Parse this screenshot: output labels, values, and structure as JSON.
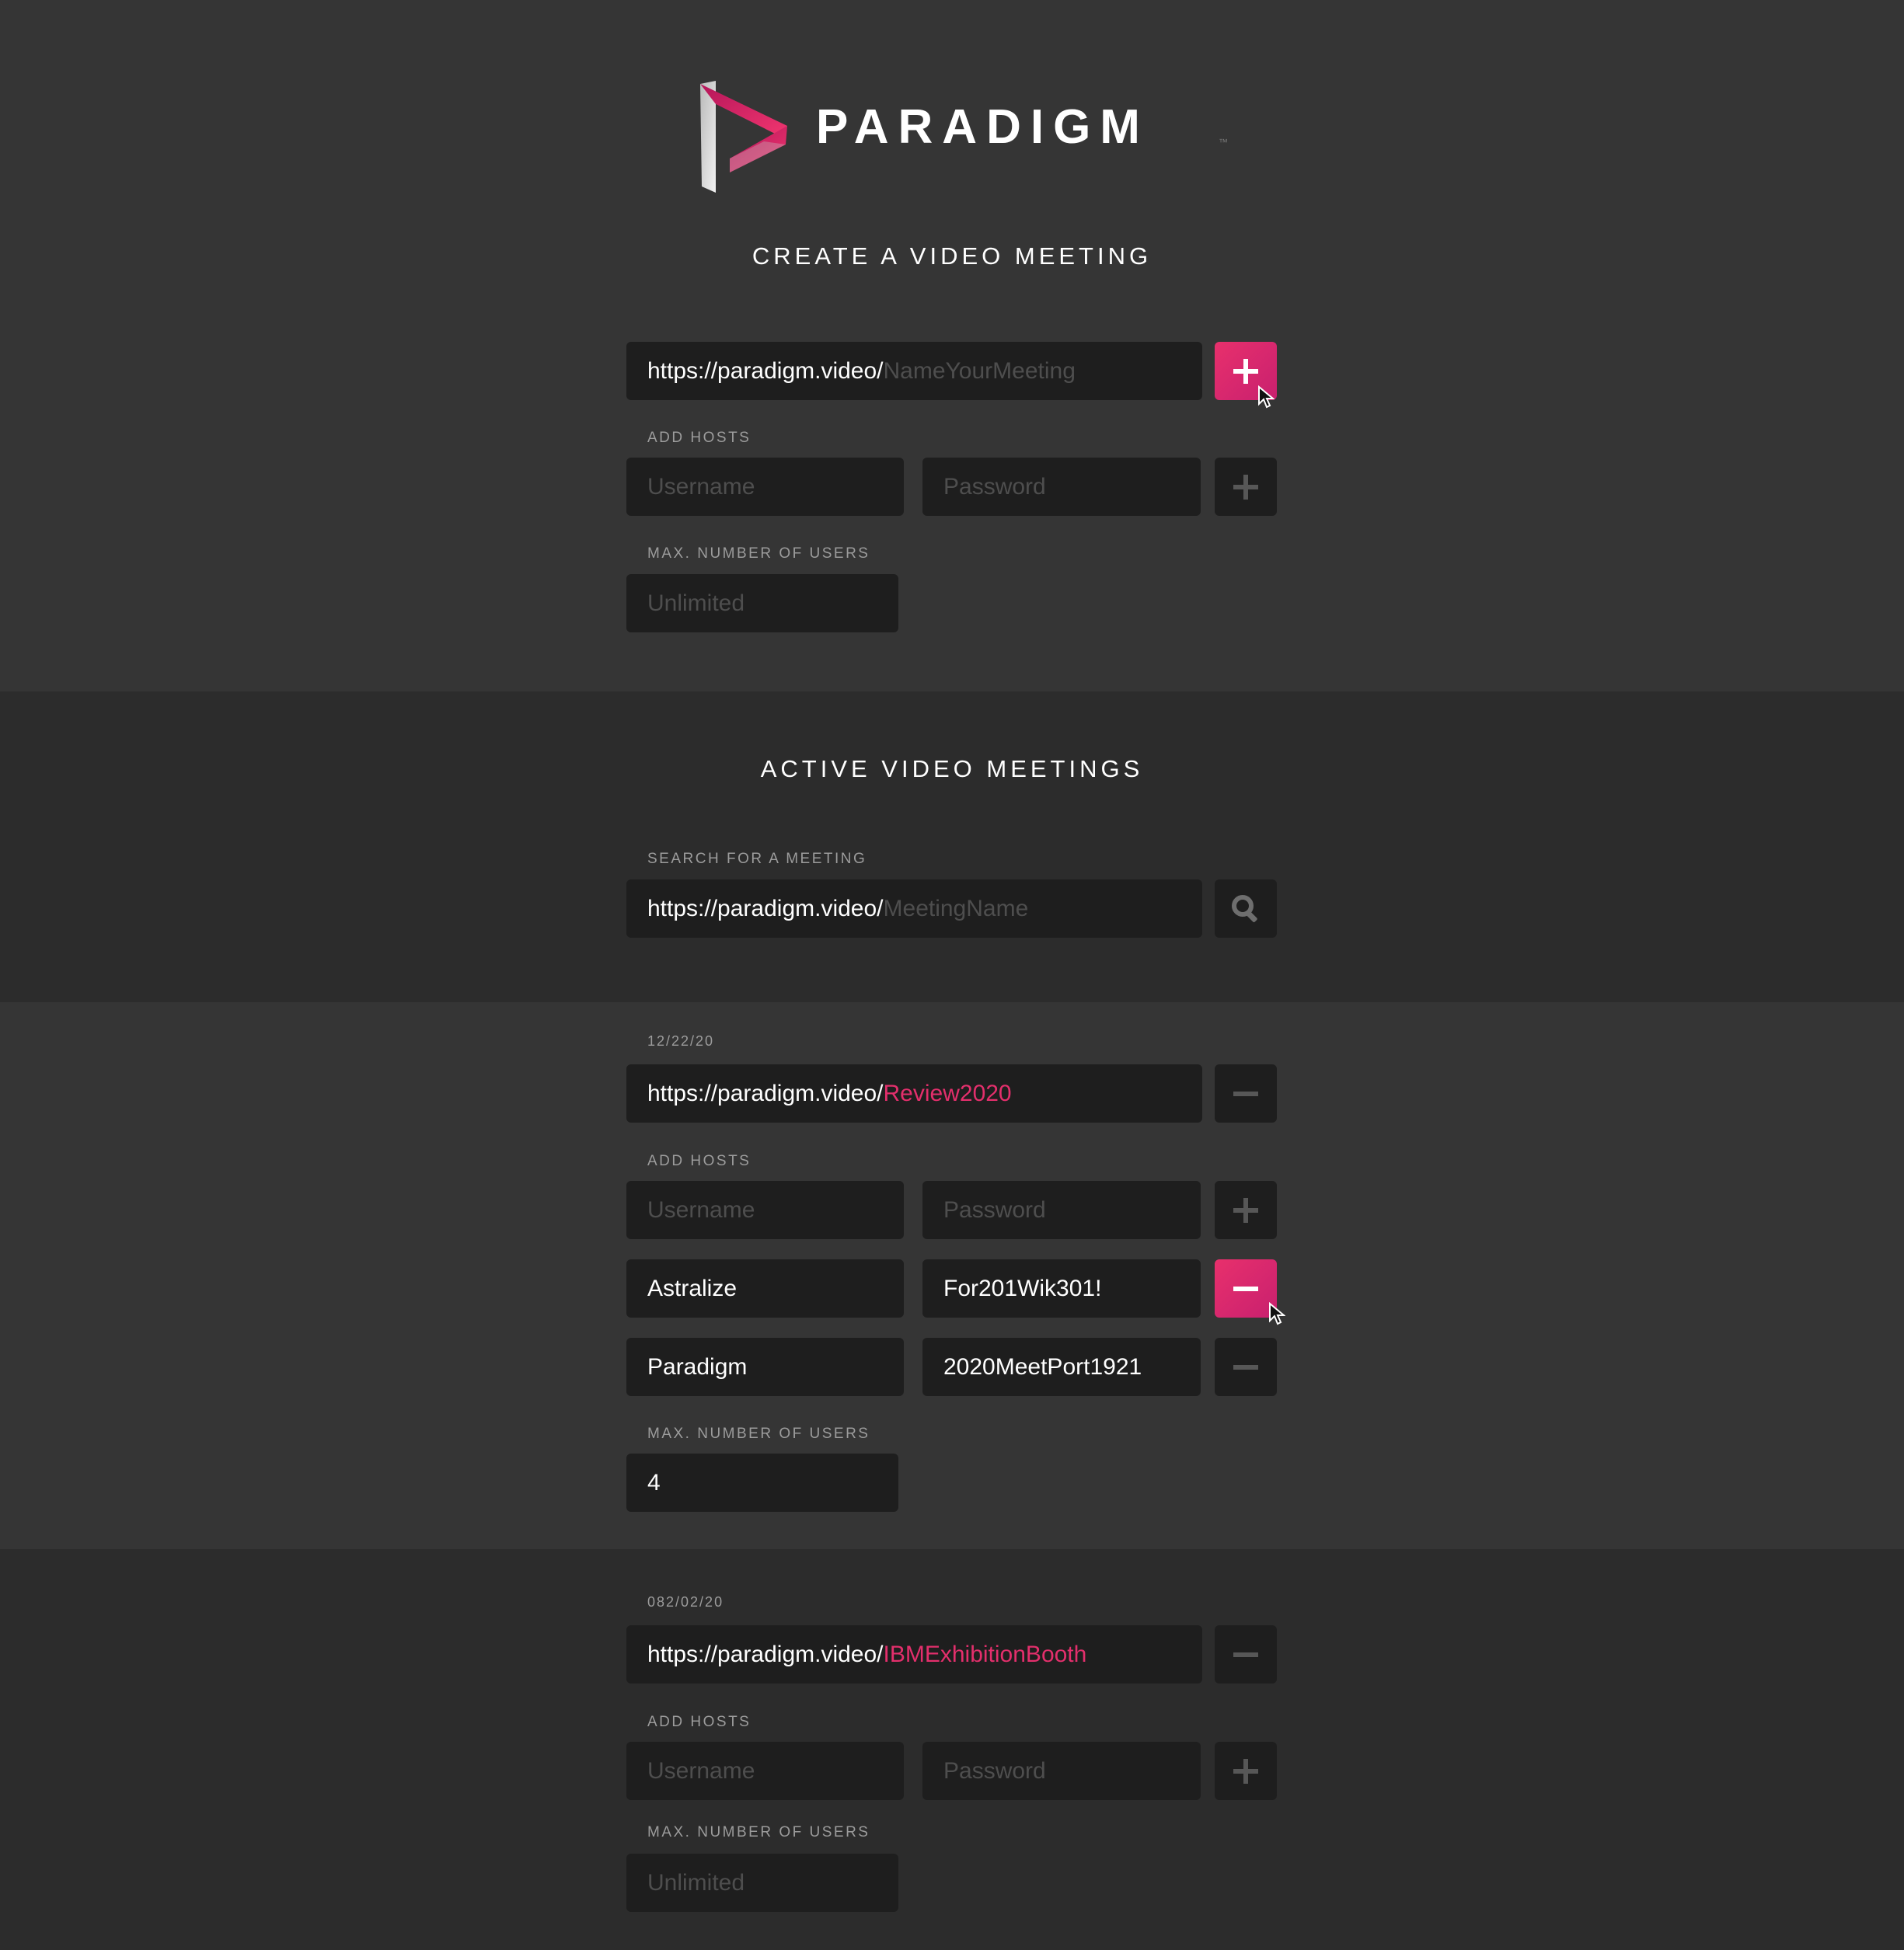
{
  "brand": {
    "name": "PARADIGM",
    "tm": "™"
  },
  "create": {
    "heading": "CREATE A VIDEO MEETING",
    "url_prefix": "https://paradigm.video/",
    "url_placeholder": "NameYourMeeting",
    "add_hosts_label": "ADD HOSTS",
    "username_placeholder": "Username",
    "password_placeholder": "Password",
    "max_users_label": "MAX. NUMBER OF USERS",
    "max_users_placeholder": "Unlimited"
  },
  "active": {
    "heading": "ACTIVE VIDEO MEETINGS",
    "search_label": "SEARCH FOR A MEETING",
    "url_prefix": "https://paradigm.video/",
    "search_placeholder": "MeetingName"
  },
  "meetings": [
    {
      "date": "12/22/20",
      "url_prefix": "https://paradigm.video/",
      "name": "Review2020",
      "add_hosts_label": "ADD HOSTS",
      "username_placeholder": "Username",
      "password_placeholder": "Password",
      "hosts": [
        {
          "username": "Astralize",
          "password": "For201Wik301!"
        },
        {
          "username": "Paradigm",
          "password": "2020MeetPort1921"
        }
      ],
      "max_users_label": "MAX. NUMBER OF USERS",
      "max_users": "4"
    },
    {
      "date": "082/02/20",
      "url_prefix": "https://paradigm.video/",
      "name": "IBMExhibitionBooth",
      "add_hosts_label": "ADD HOSTS",
      "username_placeholder": "Username",
      "password_placeholder": "Password",
      "max_users_label": "MAX. NUMBER OF USERS",
      "max_users_placeholder": "Unlimited"
    }
  ],
  "colors": {
    "accent": "#e32f6c",
    "background": "#353535",
    "band": "#2c2c2c",
    "field": "#1e1e1e",
    "icon": "#575757"
  },
  "icons": {
    "logo": "paradigm-play-logo",
    "add": "plus-icon",
    "remove": "minus-icon",
    "search": "search-icon",
    "cursor": "mouse-pointer-icon"
  }
}
